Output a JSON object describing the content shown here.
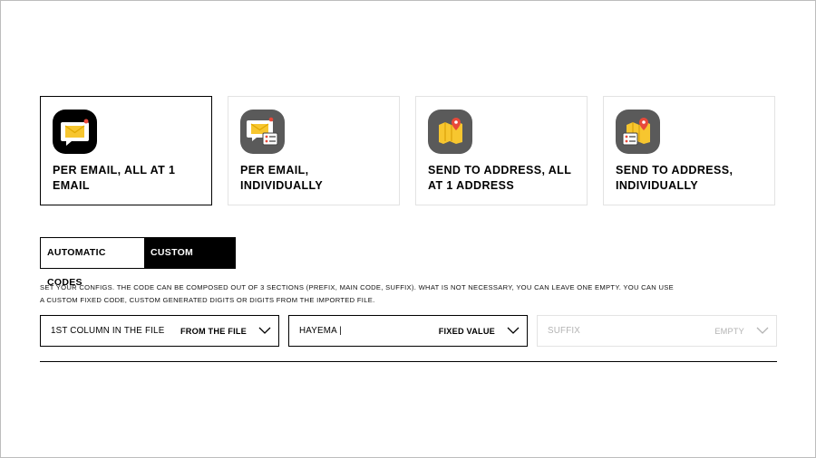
{
  "send_options": [
    {
      "label": "PER EMAIL, ALL AT 1 EMAIL",
      "icon": "email-bubble-icon",
      "selected": true
    },
    {
      "label": "PER EMAIL, INDIVIDUALLY",
      "icon": "email-individual-icon",
      "selected": false
    },
    {
      "label": "SEND TO ADDRESS, ALL AT 1 ADDRESS",
      "icon": "map-pin-icon",
      "selected": false
    },
    {
      "label": "SEND TO ADDRESS, INDIVIDUALLY",
      "icon": "map-individual-icon",
      "selected": false
    }
  ],
  "code_tabs": {
    "automatic": "AUTOMATIC CODES",
    "custom": "CUSTOM CODES",
    "active": "custom"
  },
  "description": "SET YOUR CONFIGS. THE CODE CAN BE COMPOSED OUT OF 3 SECTIONS (PREFIX, MAIN CODE, SUFFIX). WHAT IS NOT NECESSARY, YOU CAN LEAVE ONE EMPTY. YOU CAN USE A CUSTOM FIXED CODE, CUSTOM GENERATED DIGITS OR DIGITS FROM THE IMPORTED FILE.",
  "sections": {
    "prefix": {
      "value": "1ST COLUMN IN THE FILE",
      "mode": "FROM THE FILE"
    },
    "main": {
      "value": "HAYEMA |",
      "mode": "FIXED VALUE"
    },
    "suffix": {
      "placeholder": "SUFFIX",
      "mode": "EMPTY"
    }
  },
  "colors": {
    "accent_yellow": "#f7c62f",
    "pin_red": "#e8493a",
    "icon_dark": "#000000",
    "icon_grey": "#5a5a5a"
  }
}
